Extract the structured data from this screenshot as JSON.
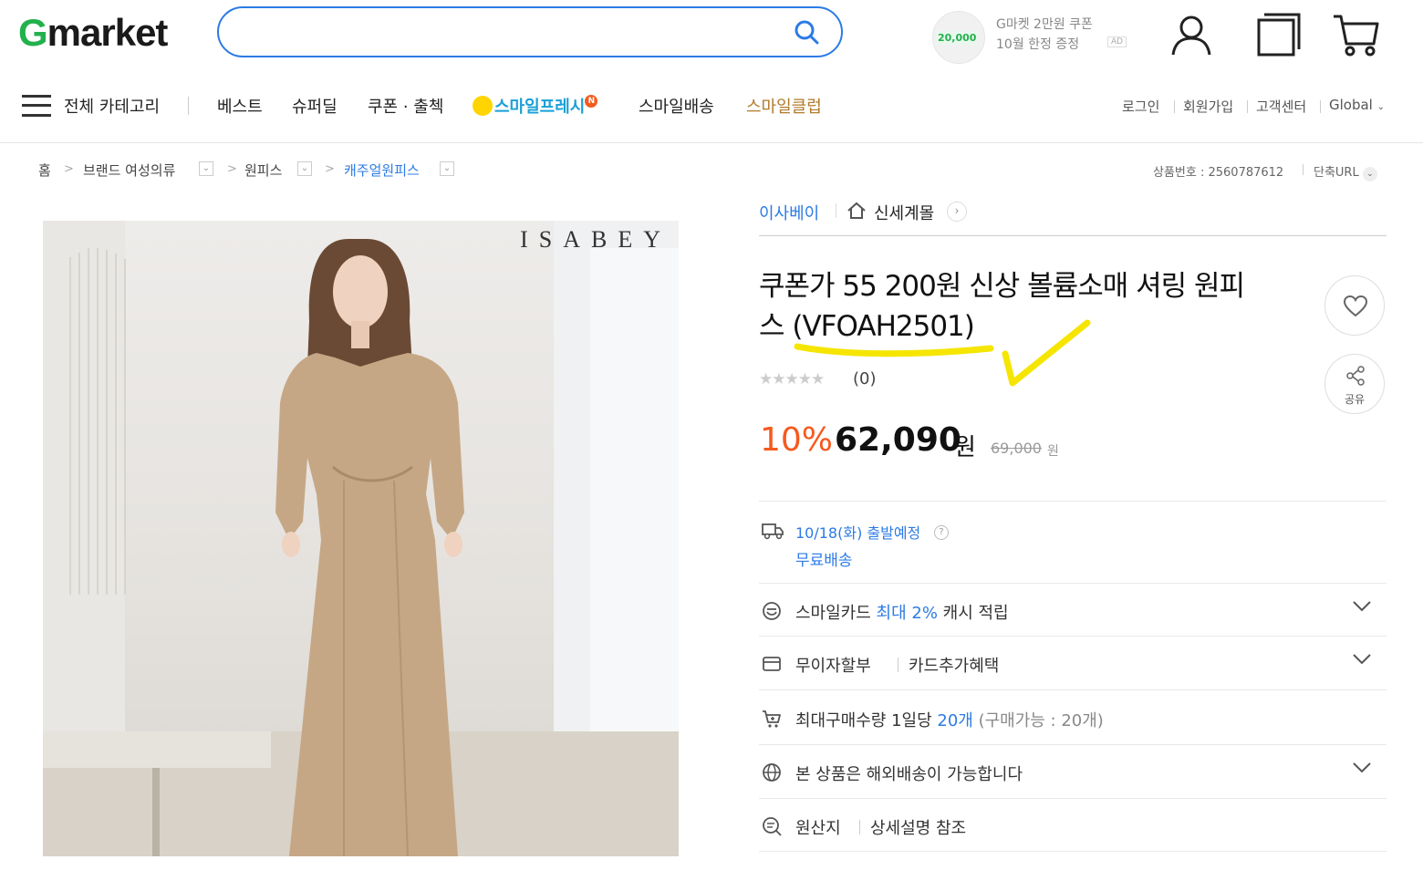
{
  "header": {
    "logo_g": "G",
    "logo_rest": "market",
    "search": {
      "placeholder": "",
      "value": ""
    },
    "ad": {
      "coin_text": "20,000",
      "line1": "G마켓 2만원 쿠폰",
      "line2": "10월 한정 증정",
      "badge": "AD"
    },
    "icons": [
      "user-icon",
      "recent-icon",
      "cart-icon"
    ]
  },
  "nav": {
    "all_category": "전체 카테고리",
    "items": [
      "베스트",
      "슈퍼딜",
      "쿠폰 · 출첵",
      "스마일프레시",
      "스마일배송",
      "스마일클럽"
    ],
    "smile_fresh_badge": "N",
    "util": [
      "로그인",
      "회원가입",
      "고객센터",
      "Global"
    ]
  },
  "breadcrumb": {
    "items": [
      "홈",
      "브랜드 여성의류",
      "원피스",
      "캐주얼원피스"
    ],
    "product_no_label": "상품번호 : 2560787612",
    "short_url": "단축URL"
  },
  "product": {
    "image_brand_text": "ISABEY",
    "seller": "이사베이",
    "store": "신세계몰",
    "title_line1": "쿠폰가 55 200원 신상 볼륨소매 셔링 원피",
    "title_line2": "스 (VFOAH2501)",
    "review_count": "(0)",
    "rating_stars": 0,
    "discount": "10%",
    "price": "62,090",
    "price_unit": "원",
    "original_price": "69,000",
    "original_unit": "원",
    "share_label": "공유",
    "shipping": {
      "date": "10/18(화) 출발예정",
      "free": "무료배송"
    },
    "smile_card": {
      "prefix": "스마일카드 ",
      "highlight": "최대 2%",
      "suffix": " 캐시 적립"
    },
    "installment": {
      "label": "무이자할부",
      "extra": "카드추가혜택"
    },
    "limit": {
      "prefix": "최대구매수량 1일당 ",
      "highlight": "20개",
      "suffix": " (구매가능 : 20개)"
    },
    "overseas": "본 상품은 해외배송이 가능합니다",
    "origin": {
      "label": "원산지",
      "value": "상세설명 참조"
    }
  },
  "colors": {
    "brand_green": "#23b14d",
    "accent_blue": "#2c7be5",
    "discount_orange": "#f55a1e",
    "annotation_yellow": "#f5e500"
  }
}
